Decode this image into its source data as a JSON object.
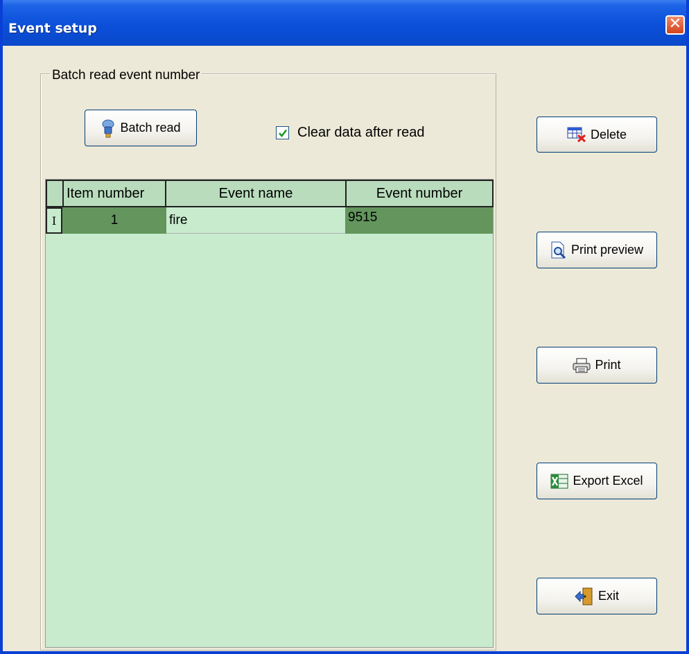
{
  "window": {
    "title": "Event setup",
    "close_glyph": "✕"
  },
  "group": {
    "label": "Batch read event number",
    "batch_read_label": "Batch read",
    "clear_after_read_label": "Clear data after read",
    "clear_after_read_checked": true
  },
  "table": {
    "columns": [
      "Item number",
      "Event name",
      "Event number"
    ],
    "rows": [
      {
        "indicator": "I",
        "item_number": "1",
        "event_name": "fire",
        "event_number": "9515"
      }
    ]
  },
  "actions": {
    "delete_label": "Delete",
    "print_preview_label": "Print preview",
    "print_label": "Print",
    "export_excel_label": "Export Excel",
    "exit_label": "Exit"
  },
  "icons": {
    "batch_read": "robot-icon",
    "delete": "delete-table-icon",
    "print_preview": "print-preview-icon",
    "print": "printer-icon",
    "export_excel": "excel-icon",
    "exit": "exit-door-icon"
  },
  "colors": {
    "titlebar": "#0b4fd9",
    "grid_background": "#c8ebce",
    "selected_cell": "#63955d"
  }
}
